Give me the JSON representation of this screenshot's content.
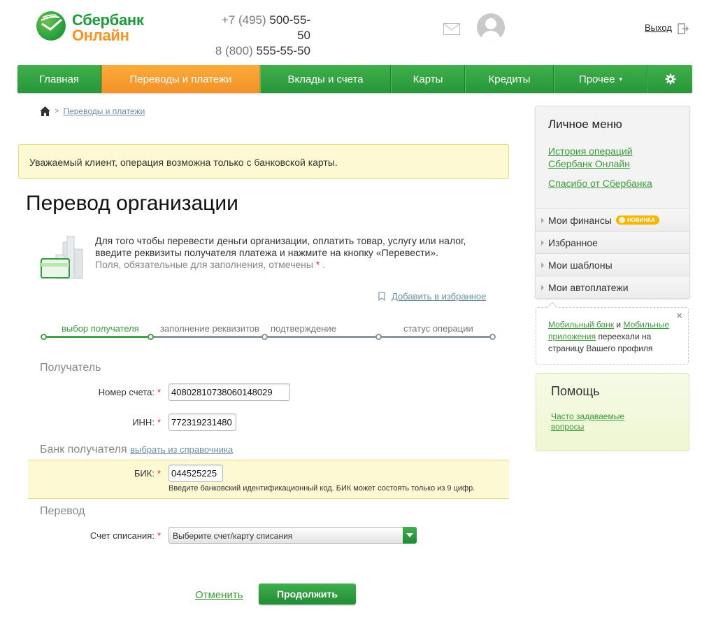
{
  "header": {
    "logo_line1": "Сбербанк",
    "logo_line2": "Онлайн",
    "phone1_code": "+7 (495)",
    "phone1_num": "500-55-50",
    "phone2_code": "8 (800)",
    "phone2_num": "555-55-50",
    "logout_label": "Выход"
  },
  "nav": {
    "items": [
      {
        "label": "Главная"
      },
      {
        "label": "Переводы и платежи",
        "active": true
      },
      {
        "label": "Вклады и счета"
      },
      {
        "label": "Карты"
      },
      {
        "label": "Кредиты"
      },
      {
        "label": "Прочее"
      }
    ],
    "settings_icon": "gear-icon"
  },
  "breadcrumb": {
    "home_icon": "home-icon",
    "current": "Переводы и платежи"
  },
  "alert": {
    "text": "Уважаемый клиент, операция возможна только с банковской карты."
  },
  "page": {
    "title": "Перевод организации",
    "intro": "Для того чтобы перевести деньги организации, оплатить товар, услугу или налог, введите реквизиты получателя платежа и нажмите на кнопку «Перевести».",
    "required_note": "Поля, обязательные для заполнения, отмечены",
    "required_mark": "*",
    "required_dot": ".",
    "favorite_label": "Добавить в избранное"
  },
  "steps": [
    {
      "label": "выбор получателя",
      "active": true
    },
    {
      "label": "заполнение реквизитов",
      "active": false
    },
    {
      "label": "подтверждение",
      "active": false
    },
    {
      "label": "статус операции",
      "active": false
    }
  ],
  "form": {
    "recipient_section": "Получатель",
    "account_label": "Номер счета:",
    "account_value": "40802810738060148029",
    "inn_label": "ИНН:",
    "inn_value": "772319231480",
    "bank_section": "Банк получателя",
    "bank_directory_link": "выбрать из справочника",
    "bik_label": "БИК:",
    "bik_value": "044525225",
    "bik_hint": "Введите банковский идентификационный код. БИК может состоять только из 9 цифр.",
    "transfer_section": "Перевод",
    "debit_label": "Счет списания:",
    "debit_placeholder": "Выберите счет/карту списания",
    "required_mark": "*",
    "cancel_label": "Отменить",
    "submit_label": "Продолжить"
  },
  "sidebar": {
    "menu_title": "Личное меню",
    "links": [
      "История операций Сбербанк Онлайн",
      "Спасибо от Сбербанка"
    ],
    "rows": [
      {
        "label": "Мои финансы",
        "badge": "НОВИНКА"
      },
      {
        "label": "Избранное"
      },
      {
        "label": "Мои шаблоны"
      },
      {
        "label": "Мои автоплатежи"
      }
    ],
    "notice": {
      "link1": "Мобильный банк",
      "and": "и",
      "link2": "Мобильные приложения",
      "rest": "переехали на страницу Вашего профиля",
      "close": "×"
    },
    "help": {
      "title": "Помощь",
      "faq": "Часто задаваемые вопросы"
    }
  },
  "colors": {
    "brand_green": "#27963a",
    "accent_orange": "#f39126",
    "alert_bg": "#fdf9d2"
  }
}
